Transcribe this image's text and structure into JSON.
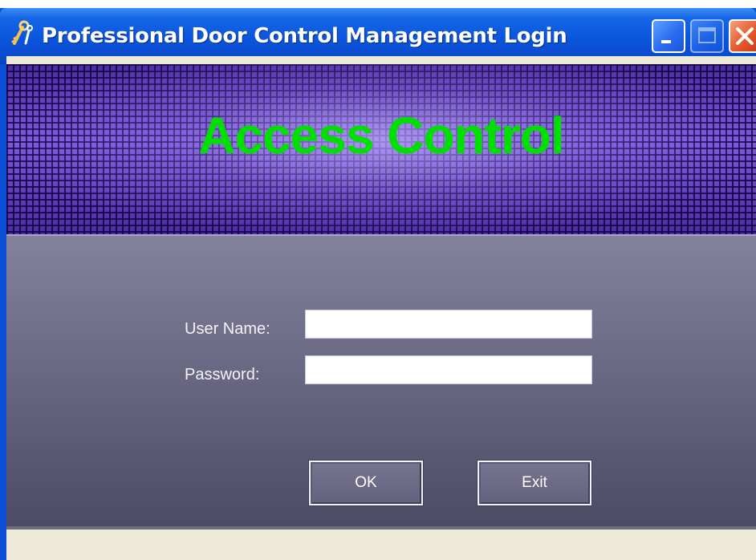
{
  "window": {
    "title": "Professional Door Control Management Login",
    "icon": "keys-icon",
    "controls": {
      "minimize": "minimize-icon",
      "maximize": "maximize-icon",
      "close": "close-icon"
    }
  },
  "banner": {
    "title": "Access Control",
    "title_color": "#00e000"
  },
  "form": {
    "username_label": "User Name:",
    "username_value": "",
    "password_label": "Password:",
    "password_value": ""
  },
  "buttons": {
    "ok_label": "OK",
    "exit_label": "Exit"
  },
  "colors": {
    "titlebar": "#0a55dc",
    "panel": "#6d6b85",
    "banner": "#5b3fa8"
  }
}
